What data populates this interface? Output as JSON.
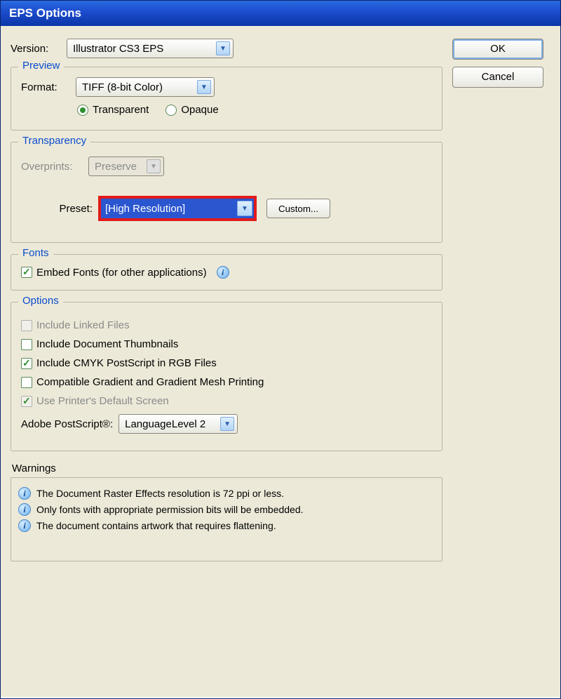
{
  "window": {
    "title": "EPS Options"
  },
  "buttons": {
    "ok": "OK",
    "cancel": "Cancel",
    "custom": "Custom..."
  },
  "version": {
    "label": "Version:",
    "value": "Illustrator CS3 EPS"
  },
  "preview": {
    "legend": "Preview",
    "format_label": "Format:",
    "format_value": "TIFF (8-bit Color)",
    "transparent": "Transparent",
    "opaque": "Opaque"
  },
  "transparency": {
    "legend": "Transparency",
    "overprints_label": "Overprints:",
    "overprints_value": "Preserve",
    "preset_label": "Preset:",
    "preset_value": "[High Resolution]"
  },
  "fonts": {
    "legend": "Fonts",
    "embed": "Embed Fonts (for other applications)"
  },
  "options": {
    "legend": "Options",
    "linked": "Include Linked Files",
    "thumbs": "Include Document Thumbnails",
    "cmyk": "Include CMYK PostScript in RGB Files",
    "gradient": "Compatible Gradient and Gradient Mesh Printing",
    "printer": "Use Printer's Default Screen",
    "postscript_label": "Adobe PostScript®:",
    "postscript_value": "LanguageLevel 2"
  },
  "warnings": {
    "label": "Warnings",
    "items": [
      "The Document Raster Effects resolution is 72 ppi or less.",
      "Only fonts with appropriate permission bits will be embedded.",
      "The document contains artwork that requires flattening."
    ]
  }
}
